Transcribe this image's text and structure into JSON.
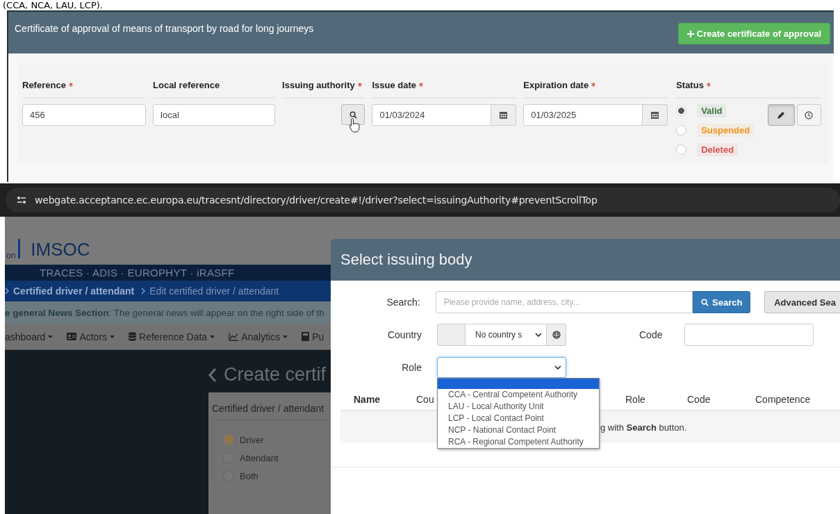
{
  "caption": "(CCA, NCA, LAU, LCP).",
  "certificate_panel": {
    "title": "Certificate of approval of means of transport by road for long journeys",
    "create_button": "Create certificate of approval",
    "fields": [
      {
        "kind": "text",
        "label": "Reference",
        "required": true,
        "value": "456"
      },
      {
        "kind": "text",
        "label": "Local reference",
        "required": false,
        "value": "local"
      },
      {
        "kind": "lookup",
        "label": "Issuing authority",
        "required": true
      },
      {
        "kind": "date",
        "label": "Issue date",
        "required": true,
        "value": "01/03/2024"
      },
      {
        "kind": "date",
        "label": "Expiration date",
        "required": true,
        "value": "01/03/2025"
      }
    ],
    "status": {
      "label": "Status",
      "required": true,
      "options": [
        {
          "label": "Valid",
          "selected": true,
          "color": "#3c763d"
        },
        {
          "label": "Suspended",
          "selected": false,
          "color": "#f0931e"
        },
        {
          "label": "Deleted",
          "selected": false,
          "color": "#d9534f"
        }
      ]
    },
    "action_buttons": [
      {
        "kind": "edit",
        "pressed": true
      },
      {
        "kind": "history",
        "pressed": false
      }
    ]
  },
  "address_bar": {
    "url": "webgate.acceptance.ec.europa.eu/tracesnt/directory/driver/create#!/driver?select=issuingAuthority#preventScrollTop"
  },
  "background_page": {
    "logo_fragment": "on",
    "brand": "IMSOC",
    "systems": "TRACES · ADIS · EUROPHYT · iRASFF",
    "breadcrumbs": [
      {
        "label": "Certified driver / attendant",
        "current": false
      },
      {
        "label": "Edit certified driver / attendant",
        "current": true
      }
    ],
    "news": "**e general News Section**: The general news will appear on the right side of th",
    "menu": [
      {
        "kind": "plain",
        "label": "ashboard",
        "dropdown": true
      },
      {
        "kind": "actors",
        "label": "Actors",
        "dropdown": true
      },
      {
        "kind": "reference",
        "label": "Reference Data",
        "dropdown": true
      },
      {
        "kind": "analytics",
        "label": "Analytics",
        "dropdown": true
      },
      {
        "kind": "publications",
        "label": "Pu",
        "dropdown": false
      }
    ],
    "page_title": "Create certif",
    "card": {
      "legend": "Certified driver / attendant",
      "options": [
        {
          "label": "Driver",
          "selected": true
        },
        {
          "label": "Attendant",
          "selected": false
        },
        {
          "label": "Both",
          "selected": false
        }
      ]
    }
  },
  "dialog": {
    "title": "Select issuing body",
    "search_label": "Search:",
    "search_placeholder": "Please provide name, address, city...",
    "search_button": "Search",
    "advanced_button": "Advanced Sea",
    "country_label": "Country",
    "country_value": "No country s",
    "code_label": "Code",
    "role_label": "Role",
    "role_list": {
      "blank_option_highlighted": true,
      "options": [
        "CCA - Central Competent Authority",
        "LAU - Local Authority Unit",
        "LCP - Local Contact Point",
        "NCP - National Contact Point",
        "RCA - Regional Competent Authority"
      ]
    },
    "columns": [
      "Name",
      "Cou",
      "Role",
      "Code",
      "Competence"
    ],
    "empty_message": "g with **Search** button."
  }
}
